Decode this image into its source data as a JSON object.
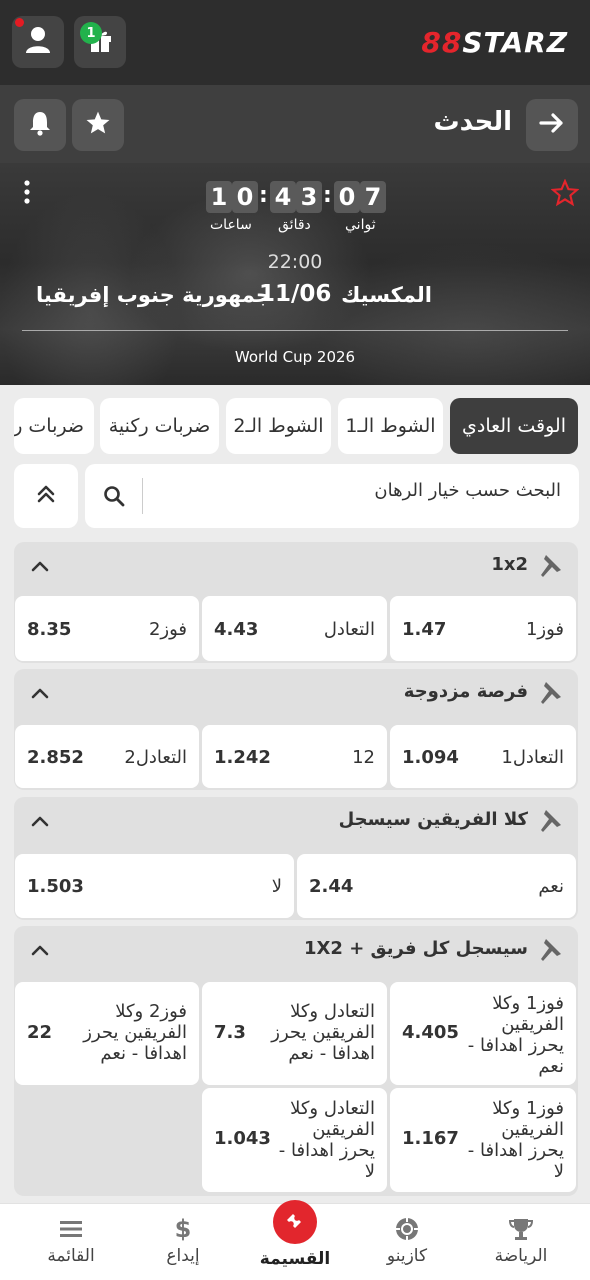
{
  "header": {
    "logo_prefix": "88",
    "logo_text": "STARZ",
    "gift_count": "1",
    "icons": [
      "user-icon",
      "gift-icon"
    ],
    "accent": "#e4252c"
  },
  "subheader": {
    "title": "الحدث",
    "icons": [
      "arrow-right-icon",
      "star-icon",
      "bell-icon"
    ]
  },
  "event": {
    "countdown": {
      "hours": [
        "1",
        "0"
      ],
      "minutes": [
        "4",
        "3"
      ],
      "seconds": [
        "0",
        "7"
      ],
      "hours_label": "ساعات",
      "minutes_label": "دقائق",
      "seconds_label": "ثواني"
    },
    "time": "22:00",
    "team1": "المكسيك",
    "date": "11/06",
    "team2": "جمهورية جنوب إفريقيا",
    "tournament": "World Cup 2026"
  },
  "tabs": [
    {
      "label": "الوقت العادي",
      "active": true
    },
    {
      "label": "الشوط الـ1",
      "active": false
    },
    {
      "label": "الشوط الـ2",
      "active": false
    },
    {
      "label": "ضربات ركنية",
      "active": false
    },
    {
      "label": "ضربات ركنية",
      "active": false
    }
  ],
  "search": {
    "placeholder": "البحث حسب خيار الرهان"
  },
  "markets": [
    {
      "title": "1x2",
      "outcomes": [
        {
          "label": "فوز1",
          "odd": "1.47"
        },
        {
          "label": "التعادل",
          "odd": "4.43"
        },
        {
          "label": "فوز2",
          "odd": "8.35"
        }
      ]
    },
    {
      "title": "فرصة مزدوجة",
      "outcomes": [
        {
          "label": "1التعادل",
          "odd": "1.094"
        },
        {
          "label": "12",
          "odd": "1.242"
        },
        {
          "label": "2التعادل",
          "odd": "2.852"
        }
      ]
    },
    {
      "title": "كلا الفريقين سيسجل",
      "outcomes": [
        {
          "label": "نعم",
          "odd": "2.44"
        },
        {
          "label": "لا",
          "odd": "1.503"
        }
      ]
    },
    {
      "title": "1X2 + سيسجل كل فريق",
      "outcomes": [
        {
          "label": "فوز1 وكلا الفريقين يحرز اهدافا - نعم",
          "odd": "4.405"
        },
        {
          "label": "التعادل وكلا الفريقين يحرز اهدافا - نعم",
          "odd": "7.3"
        },
        {
          "label": "فوز2 وكلا الفريقين يحرز اهدافا - نعم",
          "odd": "22"
        },
        {
          "label": "فوز1 وكلا الفريقين يحرز اهدافا - لا",
          "odd": "1.167"
        },
        {
          "label": "التعادل وكلا الفريقين يحرز اهدافا - لا",
          "odd": "1.043"
        }
      ]
    }
  ],
  "bottom_nav": [
    {
      "label": "الرياضة",
      "icon": "trophy-icon"
    },
    {
      "label": "كازينو",
      "icon": "casino-chip-icon"
    },
    {
      "label": "القسيمة",
      "icon": "ticket-icon"
    },
    {
      "label": "إيداع",
      "icon": "dollar-icon"
    },
    {
      "label": "القائمة",
      "icon": "menu-icon"
    }
  ]
}
